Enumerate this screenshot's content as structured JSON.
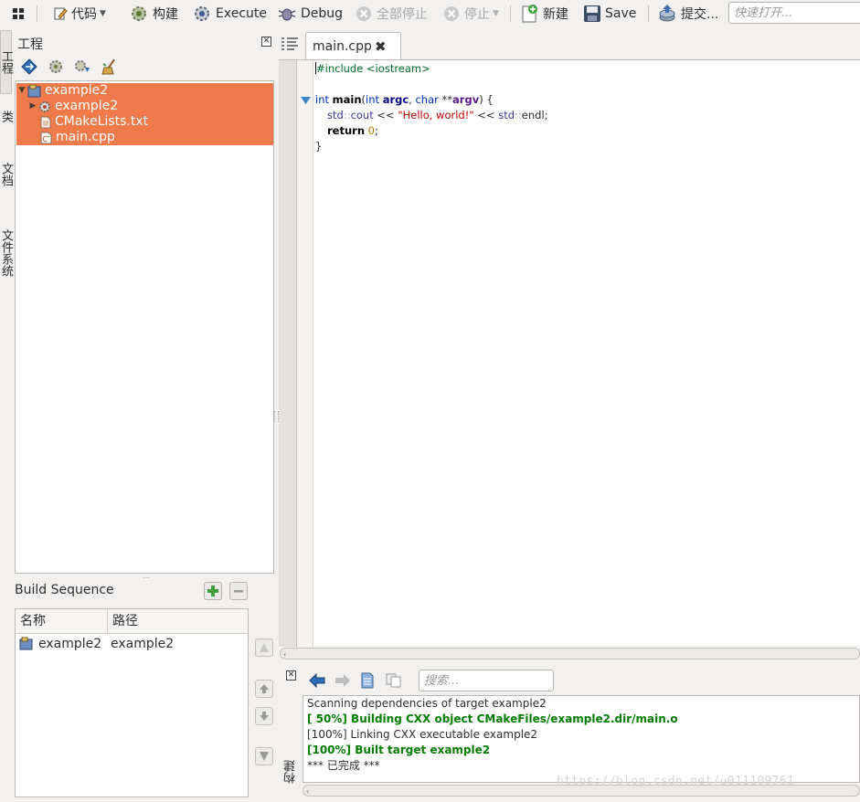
{
  "toolbar": {
    "code_label": "代码",
    "build_label": "构建",
    "execute_label": "Execute",
    "debug_label": "Debug",
    "stop_all_label": "全部停止",
    "stop_label": "停止",
    "new_label": "新建",
    "save_label": "Save",
    "commit_label": "提交...",
    "quick_open_placeholder": "快速打开..."
  },
  "side_tabs": [
    "工程",
    "类",
    "文档",
    "文件系统"
  ],
  "project_panel": {
    "title": "工程",
    "tree": [
      {
        "label": "example2",
        "icon": "project-icon",
        "expanded": true
      },
      {
        "label": "example2",
        "icon": "target-gear-icon",
        "expanded": false
      },
      {
        "label": "CMakeLists.txt",
        "icon": "text-file-icon"
      },
      {
        "label": "main.cpp",
        "icon": "cpp-file-icon"
      }
    ]
  },
  "build_sequence": {
    "title": "Build Sequence",
    "columns": [
      "名称",
      "路径"
    ],
    "rows": [
      {
        "name": "example2",
        "path": "example2"
      }
    ]
  },
  "editor": {
    "tab_label": "main.cpp",
    "code": {
      "l1_directive": "#include <iostream>",
      "l3_type": "int",
      "l3_fn": "main",
      "l3_open": "(",
      "l3_t1": "int",
      "l3_p1": "argc",
      "l3_comma": ", ",
      "l3_t2": "char",
      "l3_stars": " **",
      "l3_p2": "argv",
      "l3_close": ") {",
      "l4_ns1": "std",
      "l4_sep1": "::",
      "l4_cout": "cout",
      "l4_op1": " << ",
      "l4_str": "\"Hello, world!\"",
      "l4_op2": " << ",
      "l4_ns2": "std",
      "l4_sep2": "::",
      "l4_endl": "endl;",
      "l5_return": "return",
      "l5_num": "0",
      "l5_semi": ";",
      "l6_brace": "}"
    }
  },
  "build_output": {
    "search_placeholder": "搜索...",
    "panel_label": "构建",
    "lines": [
      {
        "text": "Scanning dependencies of target example2",
        "status": "normal"
      },
      {
        "text": "[ 50%] Building CXX object CMakeFiles/example2.dir/main.o",
        "status": "ok"
      },
      {
        "text": "[100%] Linking CXX executable example2",
        "status": "normal"
      },
      {
        "text": "[100%] Built target example2",
        "status": "ok"
      },
      {
        "text": "*** 已完成 ***",
        "status": "normal"
      }
    ]
  },
  "watermark": "https://blog.csdn.net/u011109761",
  "colors": {
    "selection": "#f07a49",
    "ok_text": "#017c01",
    "keyword": "#0033a8",
    "string": "#bf0303",
    "preprocessor": "#006e28"
  }
}
